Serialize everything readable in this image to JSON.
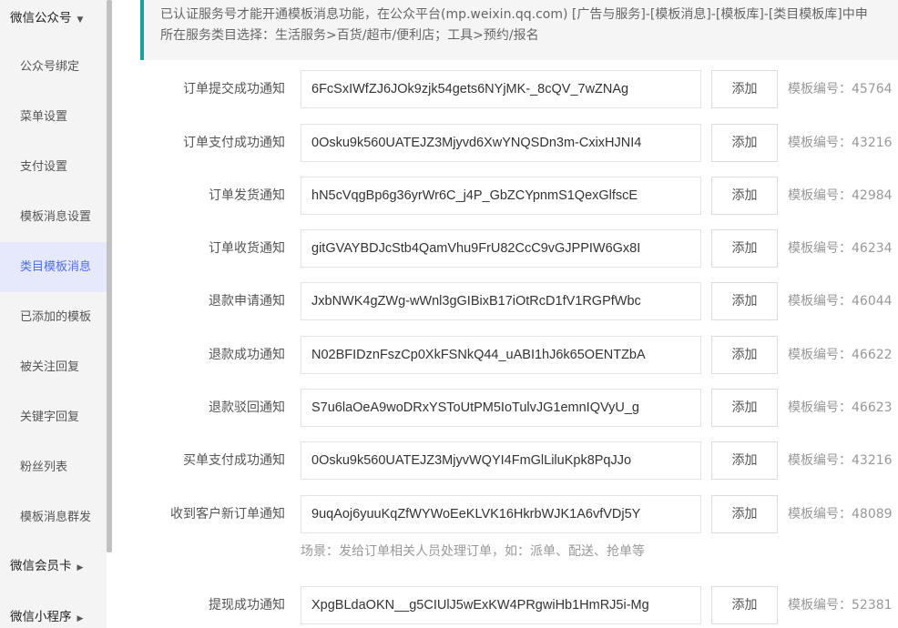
{
  "sidebar": {
    "groups": [
      {
        "label": "微信公众号",
        "caret": "▼"
      },
      {
        "label": "微信会员卡",
        "caret": "▶"
      },
      {
        "label": "微信小程序",
        "caret": "▶"
      }
    ],
    "items": [
      {
        "label": "公众号绑定"
      },
      {
        "label": "菜单设置"
      },
      {
        "label": "支付设置"
      },
      {
        "label": "模板消息设置"
      },
      {
        "label": "类目模板消息"
      },
      {
        "label": "已添加的模板"
      },
      {
        "label": "被关注回复"
      },
      {
        "label": "关键字回复"
      },
      {
        "label": "粉丝列表"
      },
      {
        "label": "模板消息群发"
      }
    ]
  },
  "notice": {
    "line1": "已认证服务号才能开通模板消息功能，在公众平台(mp.weixin.qq.com) [广告与服务]-[模板消息]-[模板库]-[类目模板库]中申",
    "line2": "所在服务类目选择：生活服务>百货/超市/便利店；工具>预约/报名"
  },
  "add_label": "添加",
  "templates": [
    {
      "name": "订单提交成功通知",
      "value": "6FcSxIWfZJ6JOk9zjk54gets6NYjMK-_8cQV_7wZNAg",
      "tid": "模板编号：45764"
    },
    {
      "name": "订单支付成功通知",
      "value": "0Osku9k560UATEJZ3Mjyvd6XwYNQSDn3m-CxixHJNI4",
      "tid": "模板编号：43216"
    },
    {
      "name": "订单发货通知",
      "value": "hN5cVqgBp6g36yrWr6C_j4P_GbZCYpnmS1QexGlfscE",
      "tid": "模板编号：42984"
    },
    {
      "name": "订单收货通知",
      "value": "gitGVAYBDJcStb4QamVhu9FrU82CcC9vGJPPIW6Gx8I",
      "tid": "模板编号：46234"
    },
    {
      "name": "退款申请通知",
      "value": "JxbNWK4gZWg-wWnl3gGIBixB17iOtRcD1fV1RGPfWbc",
      "tid": "模板编号：46044"
    },
    {
      "name": "退款成功通知",
      "value": "N02BFIDznFszCp0XkFSNkQ44_uABI1hJ6k65OENTZbA",
      "tid": "模板编号：46622"
    },
    {
      "name": "退款驳回通知",
      "value": "S7u6laOeA9woDRxYSToUtPM5IoTulvJG1emnIQVyU_g",
      "tid": "模板编号：46623"
    },
    {
      "name": "买单支付成功通知",
      "value": "0Osku9k560UATEJZ3MjyvWQYI4FmGlLiluKpk8PqJJo",
      "tid": "模板编号：43216"
    },
    {
      "name": "收到客户新订单通知",
      "value": "9uqAoj6yuuKqZfWYWoEeKLVK16HkrbWJK1A6vfVDj5Y",
      "tid": "模板编号：48089"
    },
    {
      "name": "提现成功通知",
      "value": "XpgBLdaOKN__g5CIUlJ5wExKW4PRgwiHb1HmRJ5i-Mg",
      "tid": "模板编号：52381"
    }
  ],
  "scene_note": "场景：发给订单相关人员处理订单，如：派单、配送、抢单等"
}
